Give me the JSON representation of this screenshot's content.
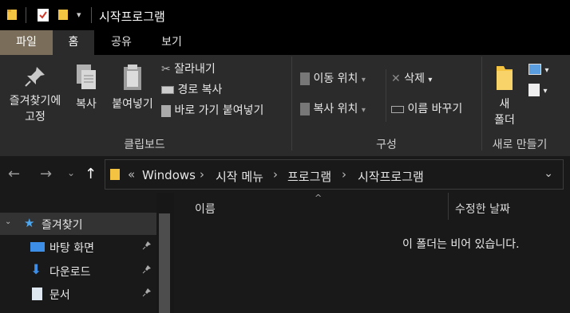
{
  "window": {
    "title": "시작프로그램"
  },
  "tabs": {
    "file": "파일",
    "home": "홈",
    "share": "공유",
    "view": "보기"
  },
  "ribbon": {
    "clipboard": {
      "pin": "즐겨찾기에\n고정",
      "pin_line1": "즐겨찾기에",
      "pin_line2": "고정",
      "copy": "복사",
      "paste": "붙여넣기",
      "cut": "잘라내기",
      "copy_path": "경로 복사",
      "paste_shortcut": "바로 가기 붙여넣기",
      "group": "클립보드"
    },
    "organize": {
      "move_to": "이동 위치",
      "copy_to": "복사 위치",
      "delete": "삭제",
      "rename": "이름 바꾸기",
      "group": "구성"
    },
    "new": {
      "new_folder_line1": "새",
      "new_folder_line2": "폴더",
      "group": "새로 만들기"
    }
  },
  "address": {
    "overflow": "«",
    "crumbs": [
      "Windows",
      "시작 메뉴",
      "프로그램",
      "시작프로그램"
    ]
  },
  "nav_pane": {
    "quick_access": "즐겨찾기",
    "items": [
      "바탕 화면",
      "다운로드",
      "문서"
    ]
  },
  "content": {
    "columns": {
      "name": "이름",
      "modified": "수정한 날짜"
    },
    "empty_message": "이 폴더는 비어 있습니다."
  }
}
